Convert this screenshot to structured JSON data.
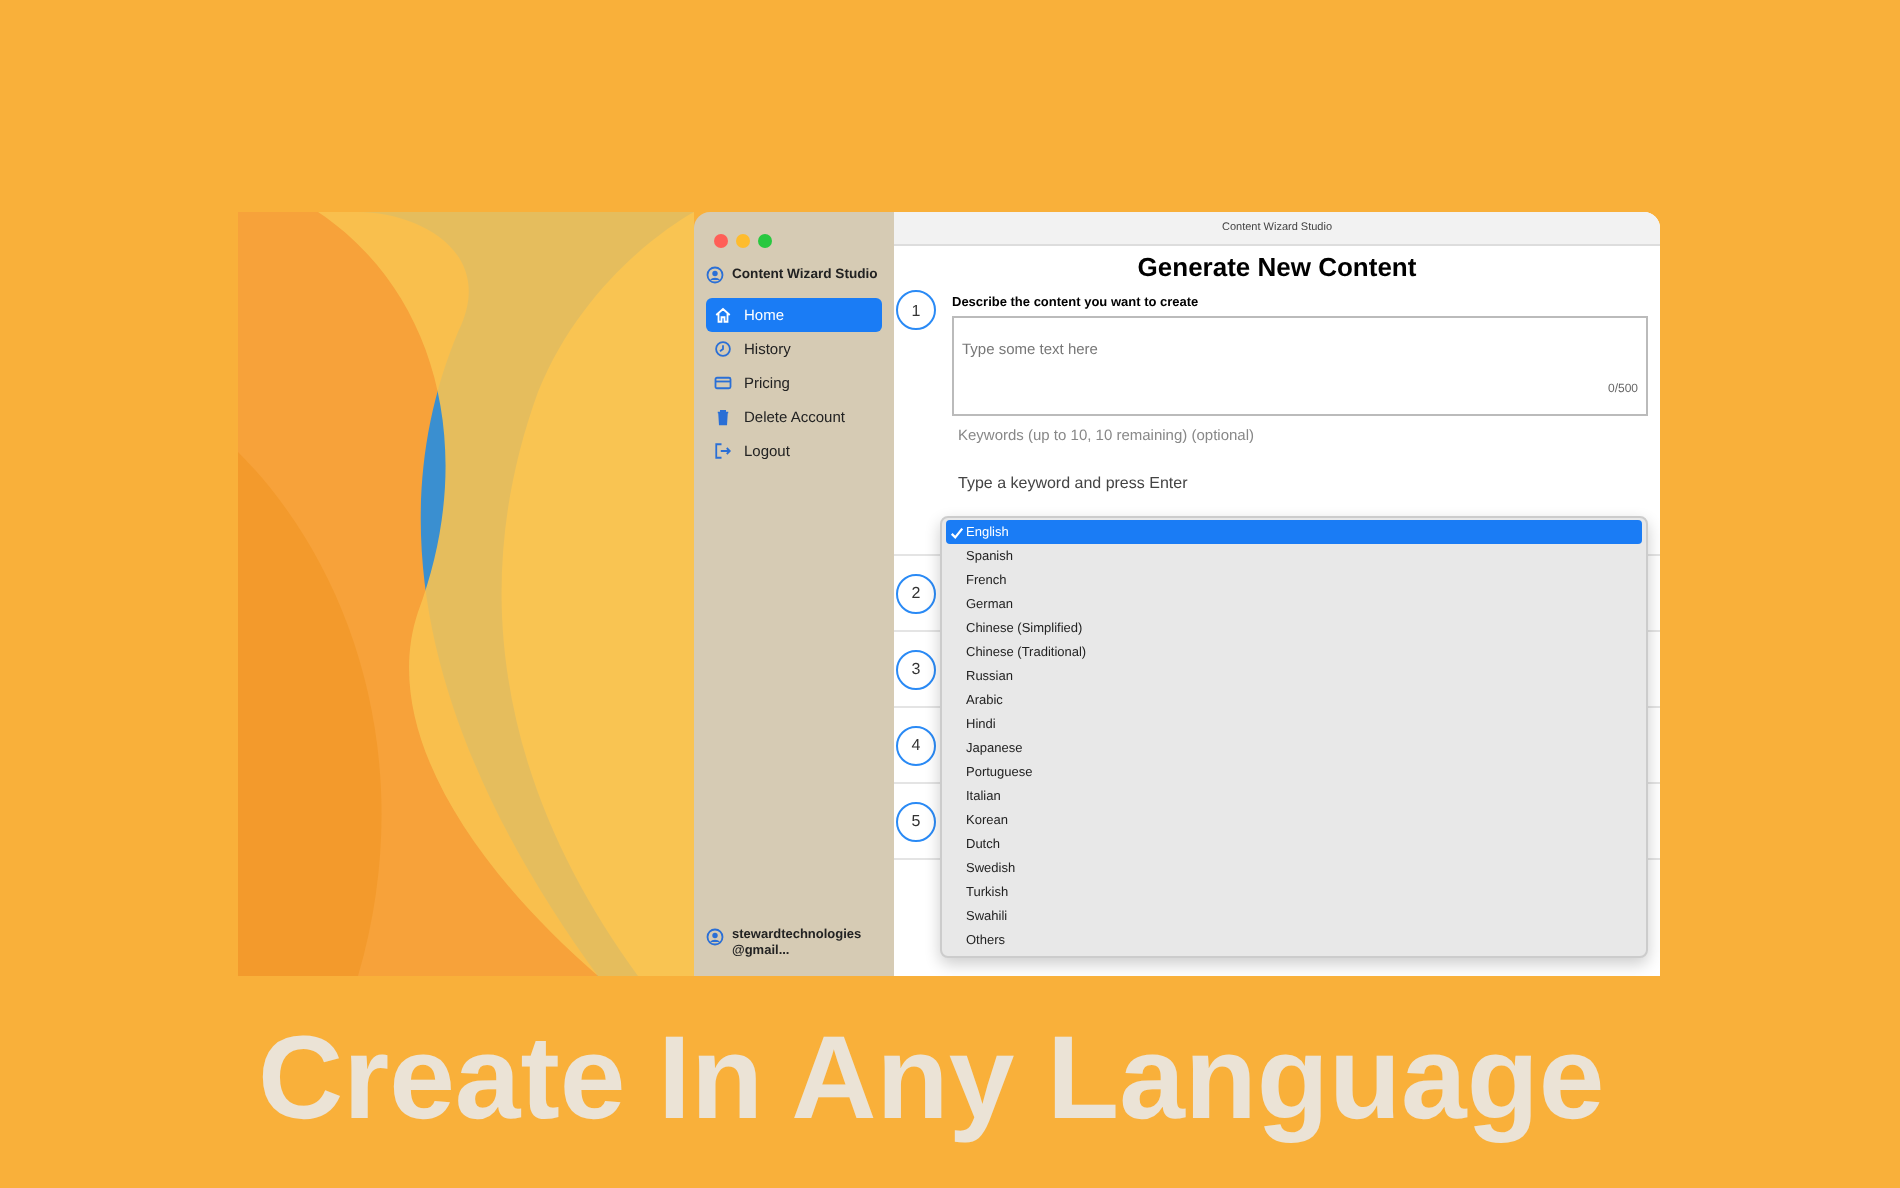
{
  "window": {
    "title": "Content Wizard Studio"
  },
  "sidebar": {
    "app_name": "Content Wizard Studio",
    "items": [
      {
        "label": "Home",
        "kind": "home",
        "selected": true
      },
      {
        "label": "History",
        "kind": "history",
        "selected": false
      },
      {
        "label": "Pricing",
        "kind": "pricing",
        "selected": false
      },
      {
        "label": "Delete Account",
        "kind": "delete",
        "selected": false
      },
      {
        "label": "Logout",
        "kind": "logout",
        "selected": false
      }
    ],
    "account": "stewardtechnologies\n@gmail..."
  },
  "main": {
    "heading": "Generate New Content",
    "steps": [
      {
        "number": "1",
        "label": "Describe the content you want to create"
      },
      {
        "number": "2"
      },
      {
        "number": "3"
      },
      {
        "number": "4"
      },
      {
        "number": "5"
      }
    ],
    "description": {
      "placeholder": "Type some text here",
      "counter": "0/500"
    },
    "keywords": {
      "label": "Keywords (up to 10, 10 remaining) (optional)",
      "placeholder": "Type a keyword and press Enter"
    },
    "language_menu": [
      {
        "label": "English",
        "selected": true
      },
      {
        "label": "Spanish",
        "selected": false
      },
      {
        "label": "French",
        "selected": false
      },
      {
        "label": "German",
        "selected": false
      },
      {
        "label": "Chinese (Simplified)",
        "selected": false
      },
      {
        "label": "Chinese (Traditional)",
        "selected": false
      },
      {
        "label": "Russian",
        "selected": false
      },
      {
        "label": "Arabic",
        "selected": false
      },
      {
        "label": "Hindi",
        "selected": false
      },
      {
        "label": "Japanese",
        "selected": false
      },
      {
        "label": "Portuguese",
        "selected": false
      },
      {
        "label": "Italian",
        "selected": false
      },
      {
        "label": "Korean",
        "selected": false
      },
      {
        "label": "Dutch",
        "selected": false
      },
      {
        "label": "Swedish",
        "selected": false
      },
      {
        "label": "Turkish",
        "selected": false
      },
      {
        "label": "Swahili",
        "selected": false
      },
      {
        "label": "Others",
        "selected": false
      }
    ]
  },
  "caption": "Create In Any Language"
}
